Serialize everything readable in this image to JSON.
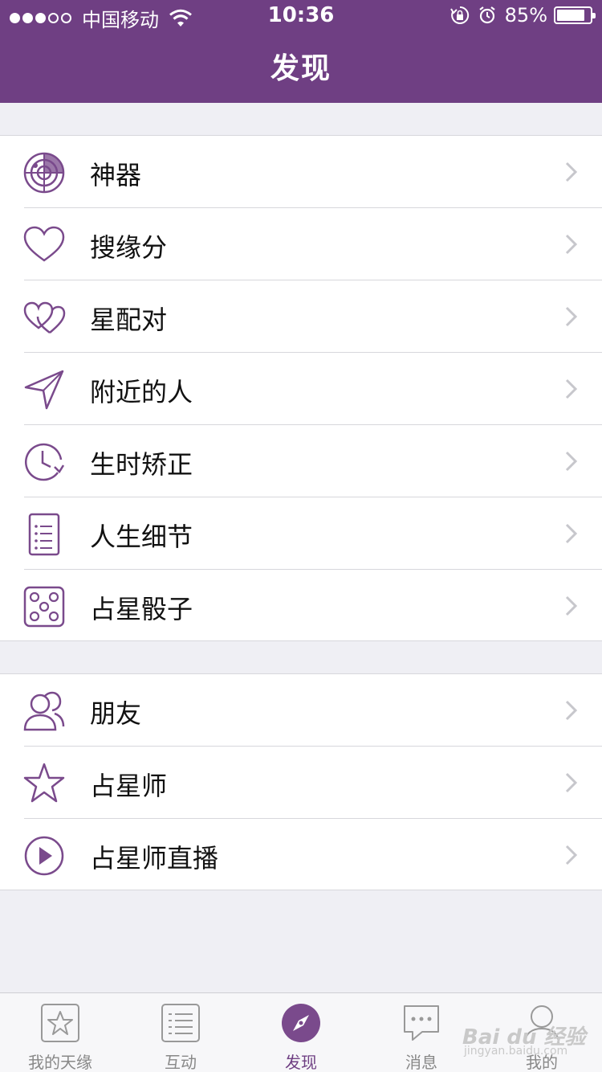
{
  "status_bar": {
    "carrier": "中国移动",
    "time": "10:36",
    "battery_percent": "85%",
    "battery_level": 0.85,
    "signal_dots_filled": 3,
    "signal_dots_total": 5
  },
  "nav": {
    "title": "发现"
  },
  "colors": {
    "brand": "#6f3f83",
    "icon": "#7a4a8c",
    "tab_inactive": "#888888"
  },
  "groups": [
    {
      "items": [
        {
          "label": "神器",
          "icon": "radar-icon"
        },
        {
          "label": "搜缘分",
          "icon": "heart-icon"
        },
        {
          "label": "星配对",
          "icon": "double-heart-icon"
        },
        {
          "label": "附近的人",
          "icon": "location-arrow-icon"
        },
        {
          "label": "生时矫正",
          "icon": "clock-refresh-icon"
        },
        {
          "label": "人生细节",
          "icon": "list-document-icon"
        },
        {
          "label": "占星骰子",
          "icon": "dice-icon"
        }
      ]
    },
    {
      "items": [
        {
          "label": "朋友",
          "icon": "friends-icon"
        },
        {
          "label": "占星师",
          "icon": "star-icon"
        },
        {
          "label": "占星师直播",
          "icon": "play-circle-icon"
        }
      ]
    }
  ],
  "tabbar": {
    "tabs": [
      {
        "label": "我的天缘",
        "icon": "star-box-icon",
        "active": false
      },
      {
        "label": "互动",
        "icon": "list-box-icon",
        "active": false
      },
      {
        "label": "发现",
        "icon": "compass-icon",
        "active": true
      },
      {
        "label": "消息",
        "icon": "chat-bubble-icon",
        "active": false
      },
      {
        "label": "我的",
        "icon": "person-icon",
        "active": false
      }
    ]
  },
  "watermark": {
    "text": "Bai du 经验",
    "sub": "jingyan.baidu.com"
  }
}
